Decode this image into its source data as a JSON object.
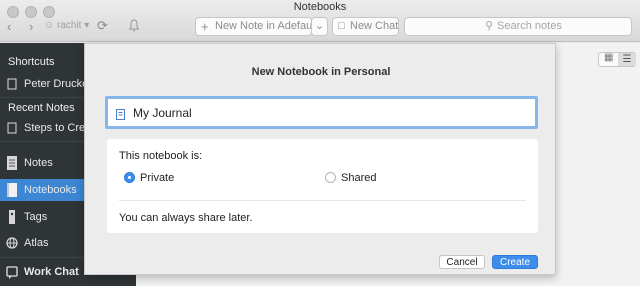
{
  "window": {
    "title": "Notebooks",
    "user": "rachit"
  },
  "toolbar": {
    "new_note_label": "New Note in Adefault",
    "new_chat_label": "New Chat",
    "search_placeholder": "Search notes"
  },
  "sidebar": {
    "shortcuts_header": "Shortcuts",
    "shortcut_item": "Peter Drucker:",
    "recent_header": "Recent Notes",
    "recent_item": "Steps to Creat",
    "nav": [
      {
        "label": "Notes"
      },
      {
        "label": "Notebooks"
      },
      {
        "label": "Tags"
      },
      {
        "label": "Atlas"
      },
      {
        "label": "Work Chat"
      }
    ]
  },
  "dialog": {
    "title": "New Notebook in Personal",
    "name_value": "My Journal",
    "sharing_question": "This notebook is:",
    "options": [
      {
        "label": "Private",
        "selected": true
      },
      {
        "label": "Shared",
        "selected": false
      }
    ],
    "hint": "You can always share later.",
    "cancel_label": "Cancel",
    "create_label": "Create"
  },
  "colors": {
    "accent": "#3c86d4",
    "sidebar_bg": "#2f3437",
    "primary_button": "#3d8ded"
  }
}
